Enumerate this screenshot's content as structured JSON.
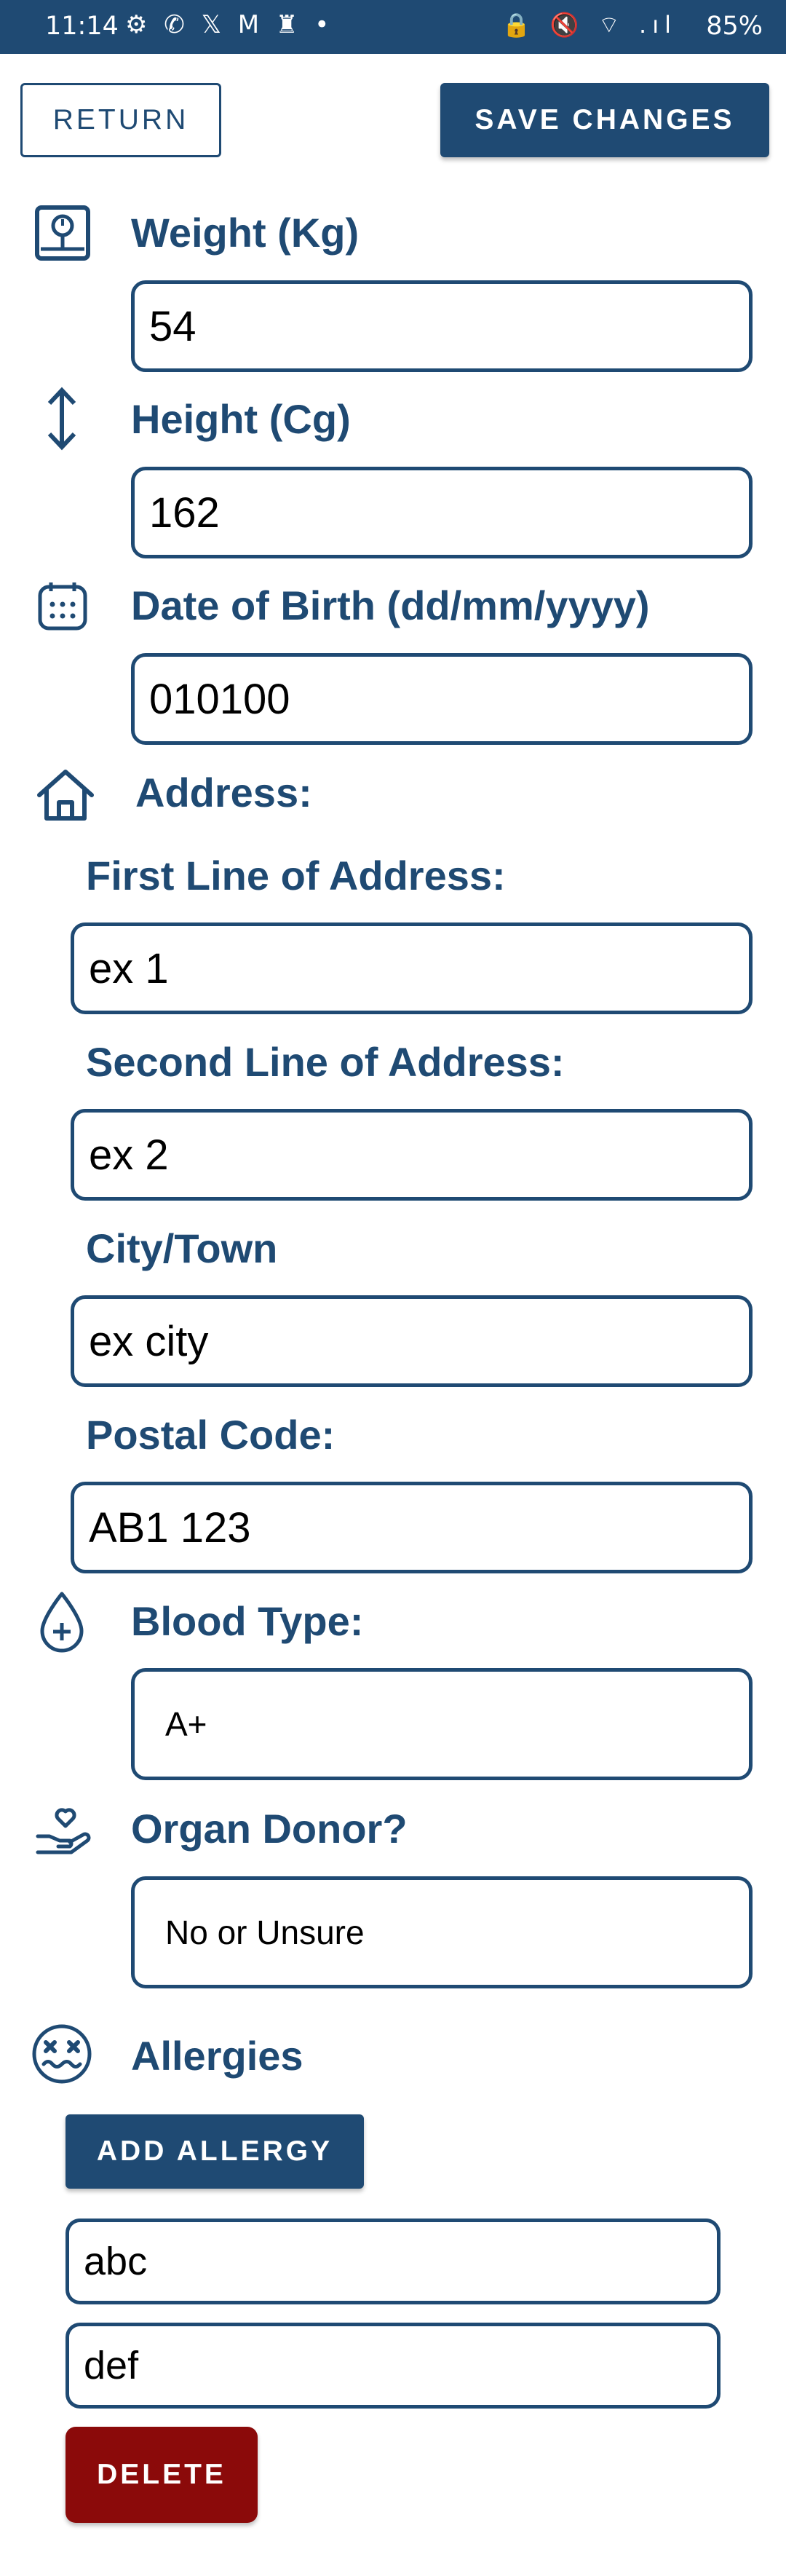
{
  "status_bar": {
    "time": "11:14",
    "left_icons": "⚙ ✆ 𝕏 M ♜ •",
    "right_icons": "🔒 🔇 ⌔ .ıl",
    "battery": "85%"
  },
  "toolbar": {
    "return_label": "RETURN",
    "save_label": "SAVE CHANGES"
  },
  "weight": {
    "label": "Weight (Kg)",
    "value": "54",
    "icon": "weight-scale-icon"
  },
  "height": {
    "label": "Height (Cg)",
    "value": "162",
    "icon": "vertical-arrows-icon"
  },
  "dob": {
    "label": "Date of Birth (dd/mm/yyyy)",
    "value": "010100",
    "icon": "calendar-icon"
  },
  "address": {
    "label": "Address:",
    "icon": "home-icon",
    "line1": {
      "label": "First Line of Address:",
      "value": "ex 1"
    },
    "line2": {
      "label": "Second Line of Address:",
      "value": "ex 2"
    },
    "city": {
      "label": "City/Town",
      "value": "ex city"
    },
    "postal": {
      "label": "Postal Code:",
      "value": "AB1 123"
    }
  },
  "blood_type": {
    "label": "Blood Type:",
    "value": "A+",
    "icon": "blood-drop-icon"
  },
  "organ_donor": {
    "label": "Organ Donor?",
    "value": "No or Unsure",
    "icon": "hand-heart-icon"
  },
  "allergies": {
    "label": "Allergies",
    "icon": "allergy-face-icon",
    "add_label": "ADD ALLERGY",
    "items": [
      "abc",
      "def"
    ],
    "delete_label": "DELETE"
  },
  "colors": {
    "primary": "#1f4a73",
    "danger": "#8b0a0a",
    "background": "#ffffff"
  }
}
